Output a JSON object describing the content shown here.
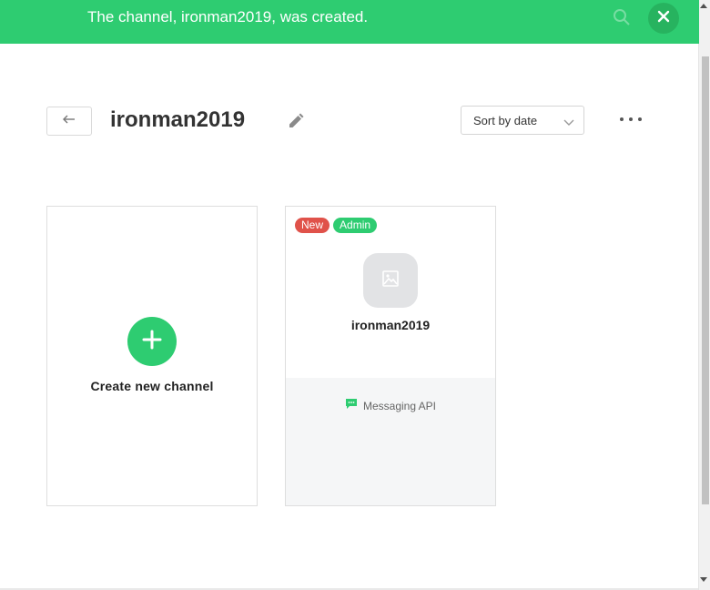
{
  "toast": {
    "message": "The channel, ironman2019, was created.",
    "close_icon": "close-icon",
    "search_icon": "search-icon"
  },
  "header": {
    "title": "ironman2019",
    "back_icon": "arrow-left-icon",
    "edit_icon": "pencil-icon",
    "more_icon": "more-horizontal-icon"
  },
  "sort": {
    "selected": "Sort by date"
  },
  "cards": {
    "create": {
      "label": "Create new channel",
      "icon": "plus-icon"
    },
    "channel": {
      "badges": [
        "New",
        "Admin"
      ],
      "name": "ironman2019",
      "type_label": "Messaging API",
      "type_icon": "chat-icon"
    }
  },
  "colors": {
    "brand_green": "#2ecc71",
    "badge_red": "#e0524a"
  }
}
